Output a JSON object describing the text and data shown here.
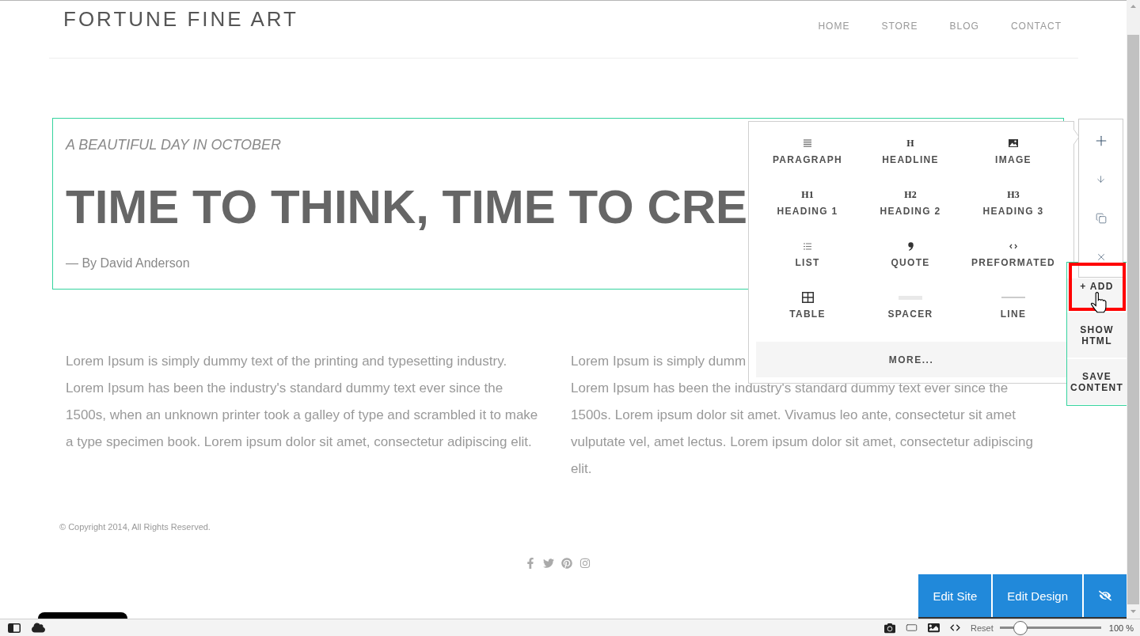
{
  "header": {
    "logo": "FORTUNE FINE ART",
    "nav": [
      "HOME",
      "STORE",
      "BLOG",
      "CONTACT"
    ]
  },
  "hero": {
    "kicker": "A BEAUTIFUL DAY IN OCTOBER",
    "headline": "TIME TO THINK, TIME TO CRE",
    "byline": "— By David Anderson"
  },
  "columns": [
    {
      "paragraphs": [
        "Lorem Ipsum is simply dummy text of the printing and typesetting industry. Lorem Ipsum has been the industry's standard dummy text ever since the 1500s, when an unknown printer took a galley of type and scrambled it to make a type specimen book. Lorem ipsum dolor sit amet, consectetur adipiscing elit."
      ]
    },
    {
      "paragraphs": [
        "Lorem Ipsum is simply dumm",
        "Lorem Ipsum has been the industry's standard dummy text ever since the 1500s. Lorem ipsum dolor sit amet. Vivamus leo ante, consectetur sit amet vulputate vel, amet lectus. Lorem ipsum dolor sit amet, consectetur adipiscing elit."
      ]
    }
  ],
  "footer": {
    "copyright": "© Copyright 2014, All Rights Reserved.",
    "social": [
      {
        "kind": "facebook"
      },
      {
        "kind": "twitter"
      },
      {
        "kind": "pinterest"
      },
      {
        "kind": "instagram"
      }
    ]
  },
  "insert_menu": {
    "rows": [
      {
        "items": [
          {
            "kind": "paragraph",
            "label": "PARAGRAPH"
          },
          {
            "kind": "glyph",
            "glyph": "H",
            "label": "HEADLINE"
          },
          {
            "kind": "image",
            "label": "IMAGE"
          }
        ]
      },
      {
        "items": [
          {
            "kind": "glyph",
            "glyph": "H1",
            "label": "HEADING 1"
          },
          {
            "kind": "glyph",
            "glyph": "H2",
            "label": "HEADING 2"
          },
          {
            "kind": "glyph",
            "glyph": "H3",
            "label": "HEADING 3"
          }
        ]
      },
      {
        "items": [
          {
            "kind": "list",
            "label": "LIST"
          },
          {
            "kind": "quote",
            "label": "QUOTE"
          },
          {
            "kind": "code",
            "label": "PREFORMATED"
          }
        ]
      },
      {
        "items": [
          {
            "kind": "table",
            "label": "TABLE"
          },
          {
            "kind": "spacer",
            "label": "SPACER"
          },
          {
            "kind": "line",
            "label": "LINE"
          }
        ]
      }
    ],
    "more": "MORE..."
  },
  "side_toolbar": {
    "tools": [
      {
        "kind": "add"
      },
      {
        "kind": "down"
      },
      {
        "kind": "copy"
      },
      {
        "kind": "remove"
      }
    ]
  },
  "side_panel": {
    "actions": [
      {
        "label": "+ ADD",
        "highlighted": true,
        "hovered": true
      },
      {
        "label": "SHOW HTML",
        "highlighted": false,
        "hovered": false
      },
      {
        "label": "SAVE CONTENT",
        "highlighted": false,
        "hovered": false
      }
    ]
  },
  "edit_bar": {
    "buttons": [
      {
        "kind": "text",
        "label": "Edit Site"
      },
      {
        "kind": "text",
        "label": "Edit Design"
      },
      {
        "kind": "preview"
      }
    ]
  },
  "status_bar": {
    "reset": "Reset",
    "zoom": {
      "level": 0.16
    },
    "zoom_label": "100 %"
  }
}
